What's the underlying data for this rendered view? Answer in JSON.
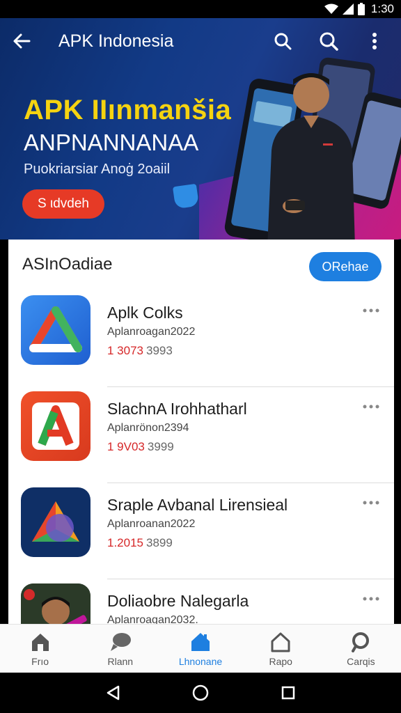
{
  "status_bar": {
    "time": "1:30"
  },
  "app_bar": {
    "title": "APK Indonesia"
  },
  "hero": {
    "title": "APK IIınmanšia",
    "subtitle": "ANPNANNANAA",
    "tagline": "Puokriarsiar Anoġ 2oaiil",
    "cta_label": "S ιdvdeh"
  },
  "section": {
    "title": "ASInOadiae",
    "button_label": "ORehae"
  },
  "apps": [
    {
      "name": "Aplk Colks",
      "subtitle": "Aplanroagan2022",
      "rank": "1 3073",
      "count": "3993",
      "icon": "drive-triangle-icon"
    },
    {
      "name": "SlachnA Irohhatharl",
      "subtitle": "Aplanrönon2394",
      "rank": "1 9V03",
      "count": "3999",
      "icon": "red-a-letter-icon"
    },
    {
      "name": "Sraple Avbanal Lirensieal",
      "subtitle": "Aplanroanan2022",
      "rank": "1.2015",
      "count": "3899",
      "icon": "colorful-triangle-icon"
    },
    {
      "name": "Doliaobre Nalegarla",
      "subtitle": "Aplanroagan2032.",
      "rank": "",
      "count": "",
      "icon": "person-photo-icon"
    }
  ],
  "bottom_nav": [
    {
      "label": "Frıo",
      "icon": "home-icon",
      "active": false
    },
    {
      "label": "Rlann",
      "icon": "chat-bubble-icon",
      "active": false
    },
    {
      "label": "Lhnonane",
      "icon": "home-filled-icon",
      "active": true
    },
    {
      "label": "Rapo",
      "icon": "house-outline-icon",
      "active": false
    },
    {
      "label": "Carqis",
      "icon": "search-bubble-icon",
      "active": false
    }
  ],
  "colors": {
    "accent": "#1e7fe0",
    "hero_title": "#f5d310",
    "cta": "#e63a26",
    "rank": "#d62728"
  }
}
